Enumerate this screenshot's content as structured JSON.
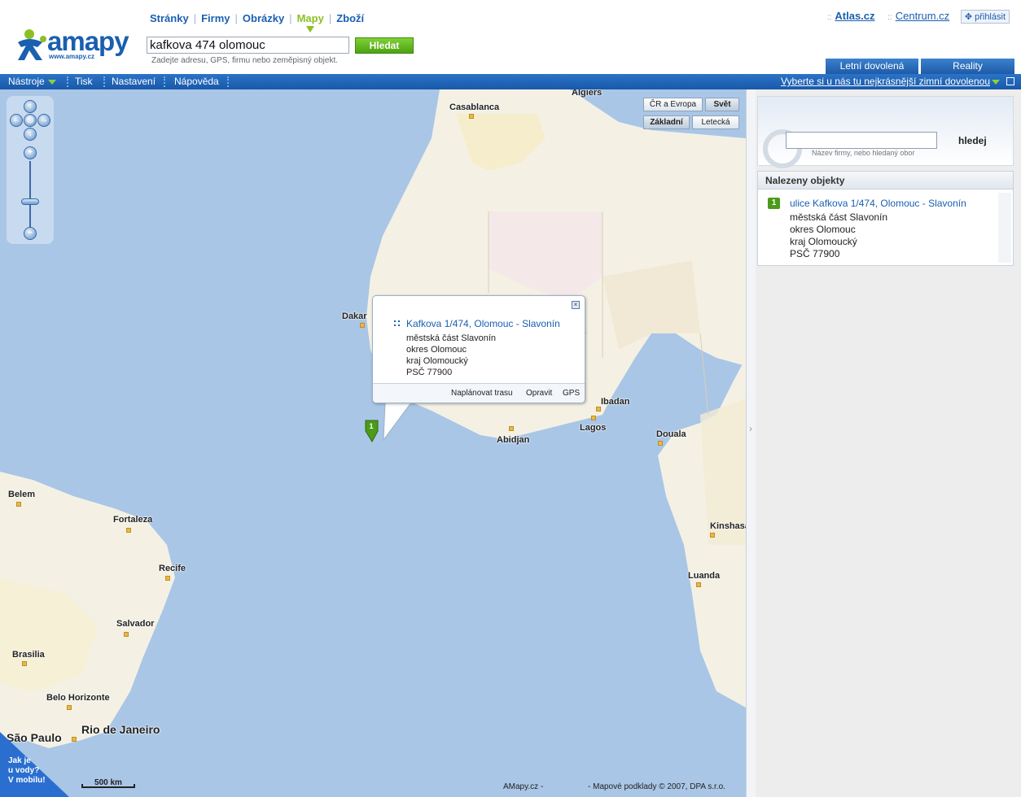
{
  "header": {
    "logo_word": "amapy",
    "logo_url": "www.amapy.cz",
    "nav": [
      "Stránky",
      "Firmy",
      "Obrázky",
      "Mapy",
      "Zboží"
    ],
    "active_nav": "Mapy",
    "search_value": "kafkova 474 olomouc",
    "search_button": "Hledat",
    "search_hint": "Zadejte adresu, GPS, firmu nebo zeměpisný objekt.",
    "links": {
      "atlas": "Atlas.cz",
      "centrum": "Centrum.cz",
      "login": "přihlásit"
    },
    "tabs": [
      "Letní dovolená",
      "Reality"
    ]
  },
  "toolbar": {
    "items": [
      "Nástroje",
      "Tisk",
      "Nastavení",
      "Nápověda"
    ],
    "promo": "Vyberte si u nás tu nejkrásnější zimní dovolenou"
  },
  "map": {
    "switch": {
      "region_a": "ČR a Evropa",
      "region_b": "Svět",
      "type_a": "Základní",
      "type_b": "Letecká"
    },
    "cities": {
      "algiers": "Algiers",
      "casablanca": "Casablanca",
      "dakar": "Dakar",
      "ibadan": "Ibadan",
      "lagos": "Lagos",
      "abidjan": "Abidjan",
      "douala": "Douala",
      "belem": "Belem",
      "fortaleza": "Fortaleza",
      "recife": "Recife",
      "kinshasa": "Kinshasa",
      "luanda": "Luanda",
      "salvador": "Salvador",
      "brasilia": "Brasilia",
      "belo_horizonte": "Belo Horizonte",
      "rio": "Rio de Janeiro",
      "sao_paulo": "São Paulo"
    },
    "popup": {
      "title": "Kafkova 1/474, Olomouc - Slavonín",
      "lines": [
        "městská část Slavonín",
        "okres Olomouc",
        "kraj Olomoucký",
        "PSČ 77900"
      ],
      "actions": [
        "Naplánovat trasu",
        "Opravit",
        "GPS"
      ]
    },
    "marker_number": "1",
    "scale": "500 km",
    "credits_left": "AMapy.cz -",
    "credits_right": "- Mapové podklady © 2007, DPA s.r.o.",
    "mobile_badge": [
      "Jak je",
      "u vody?",
      "V mobilu!"
    ]
  },
  "panel": {
    "search_button": "hledej",
    "search_hint": "Název firmy, nebo hledaný obor",
    "results_header": "Nalezeny objekty",
    "result": {
      "number": "1",
      "title": "ulice Kafkova 1/474, Olomouc - Slavonín",
      "lines": [
        "městská část Slavonín",
        "okres Olomouc",
        "kraj Olomoucký",
        "PSČ 77900"
      ]
    }
  },
  "colors": {
    "brand_blue": "#1a5fb0",
    "accent_green": "#8cbf26",
    "sea": "#a9c6e6",
    "land": "#f4f1e4"
  }
}
